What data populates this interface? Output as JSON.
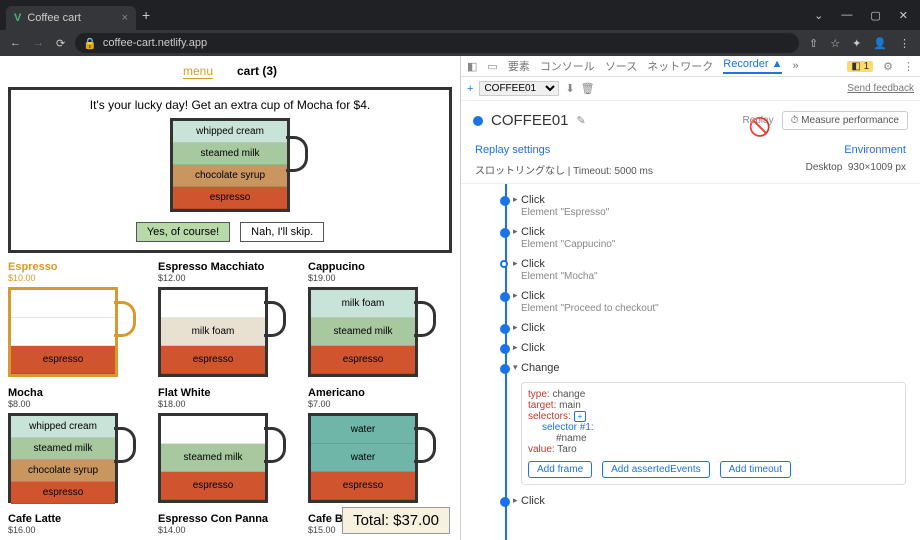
{
  "browser": {
    "tab_title": "Coffee cart",
    "url": "coffee-cart.netlify.app"
  },
  "page": {
    "menu": {
      "menu": "menu",
      "cart": "cart (3)"
    },
    "promo": {
      "text": "It's your lucky day! Get an extra cup of Mocha for $4.",
      "layers": [
        "whipped cream",
        "steamed milk",
        "chocolate syrup",
        "espresso"
      ],
      "yes": "Yes, of course!",
      "no": "Nah, I'll skip."
    },
    "items": [
      {
        "name": "Espresso",
        "price": "$10.00",
        "gold": true,
        "layers": [
          {
            "t": "",
            "c": "l-empty"
          },
          {
            "t": "",
            "c": "l-empty"
          },
          {
            "t": "espresso",
            "c": "l-esp"
          }
        ]
      },
      {
        "name": "Espresso Macchiato",
        "price": "$12.00",
        "layers": [
          {
            "t": "",
            "c": "l-empty"
          },
          {
            "t": "milk foam",
            "c": "l-foam"
          },
          {
            "t": "espresso",
            "c": "l-esp"
          }
        ]
      },
      {
        "name": "Cappucino",
        "price": "$19.00",
        "layers": [
          {
            "t": "milk foam",
            "c": "l-cream"
          },
          {
            "t": "steamed milk",
            "c": "l-milk"
          },
          {
            "t": "espresso",
            "c": "l-esp"
          }
        ]
      },
      {
        "name": "Mocha",
        "price": "$8.00",
        "layers": [
          {
            "t": "whipped cream",
            "c": "l-cream"
          },
          {
            "t": "steamed milk",
            "c": "l-milk"
          },
          {
            "t": "chocolate syrup",
            "c": "l-choc"
          },
          {
            "t": "espresso",
            "c": "l-esp"
          }
        ]
      },
      {
        "name": "Flat White",
        "price": "$18.00",
        "layers": [
          {
            "t": "",
            "c": "l-empty"
          },
          {
            "t": "steamed milk",
            "c": "l-milk"
          },
          {
            "t": "espresso",
            "c": "l-esp"
          }
        ]
      },
      {
        "name": "Americano",
        "price": "$7.00",
        "layers": [
          {
            "t": "water",
            "c": "l-water"
          },
          {
            "t": "water",
            "c": "l-water"
          },
          {
            "t": "espresso",
            "c": "l-esp"
          }
        ]
      },
      {
        "name": "Cafe Latte",
        "price": "$16.00"
      },
      {
        "name": "Espresso Con Panna",
        "price": "$14.00"
      },
      {
        "name": "Cafe Breve",
        "price": "$15.00"
      }
    ],
    "total": "Total: $37.00"
  },
  "devtools": {
    "tabs": {
      "elements": "要素",
      "console": "コンソール",
      "sources": "ソース",
      "network": "ネットワーク",
      "recorder": "Recorder ▲",
      "more": "»"
    },
    "warn_count": "1",
    "feedback": "Send feedback",
    "dropdown": "COFFEE01",
    "recording": {
      "title": "COFFEE01",
      "replay": "Replay",
      "perf": "⏱ Measure performance"
    },
    "settings": {
      "l": "Replay settings",
      "r": "Environment",
      "throttle": "スロットリングなし",
      "timeout": "Timeout: 5000 ms",
      "device": "Desktop",
      "viewport": "930×1009 px"
    },
    "steps": [
      {
        "label": "Click",
        "sub": "Element \"Espresso\"",
        "pre": true
      },
      {
        "label": "Click",
        "sub": "Element \"Cappucino\""
      },
      {
        "label": "Click",
        "sub": "Element \"Mocha\"",
        "ring": true
      },
      {
        "label": "Click",
        "sub": "Element \"Proceed to checkout\""
      },
      {
        "label": "Click",
        "sub": ""
      },
      {
        "label": "Click",
        "sub": ""
      },
      {
        "label": "Change",
        "sub": "",
        "expanded": true
      },
      {
        "label": "Click",
        "sub": ""
      }
    ],
    "change": {
      "type_k": "type:",
      "type_v": " change",
      "target_k": "target:",
      "target_v": " main",
      "selectors_k": "selectors:",
      "sel1": "selector #1:",
      "sel1v": "#name",
      "value_k": "value:",
      "value_v": " Taro",
      "btns": {
        "frame": "Add frame",
        "asserted": "Add assertedEvents",
        "timeout": "Add timeout"
      }
    }
  }
}
